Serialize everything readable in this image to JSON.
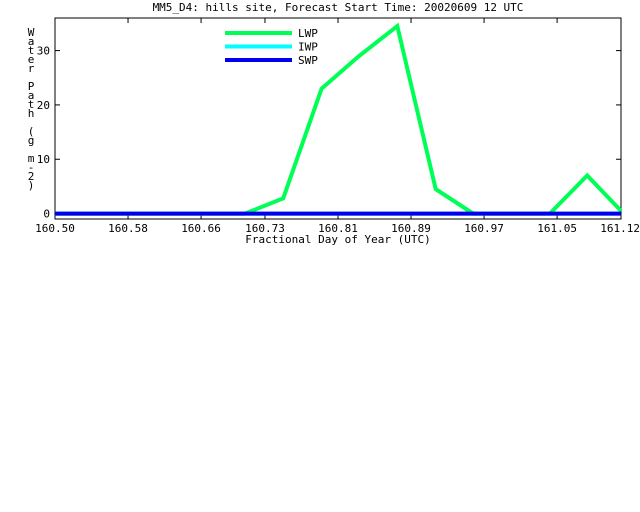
{
  "chart_data": {
    "type": "line",
    "title": "MM5_D4: hills site,  Forecast Start Time: 20020609 12 UTC",
    "xlabel": "Fractional Day of Year (UTC)",
    "ylabel": "Water Path (g m-2)",
    "ylabel_chars": [
      "W",
      "a",
      "t",
      "e",
      "r",
      "",
      "P",
      "a",
      "t",
      "h",
      "",
      "(",
      "g",
      "",
      "m",
      "-",
      "2",
      ")"
    ],
    "xlim": [
      160.5,
      161.12
    ],
    "ylim": [
      -1,
      36
    ],
    "xticks": [
      160.5,
      160.58,
      160.66,
      160.73,
      160.81,
      160.89,
      160.97,
      161.05,
      161.12
    ],
    "xtick_labels": [
      "160.50",
      "160.58",
      "160.66",
      "160.73",
      "160.81",
      "160.89",
      "160.97",
      "161.05",
      "161.12"
    ],
    "yticks": [
      0,
      10,
      20,
      30
    ],
    "ytick_labels": [
      "0",
      "10",
      "20",
      "30"
    ],
    "grid": false,
    "legend_placement": "top-center",
    "series": [
      {
        "name": "LWP",
        "color": "#00ff55",
        "x": [
          160.5,
          160.708,
          160.75,
          160.792,
          160.833,
          160.875,
          160.917,
          160.958,
          161.0,
          161.042,
          161.083,
          161.12
        ],
        "y": [
          0,
          0,
          2.8,
          23,
          29,
          34.5,
          4.5,
          0,
          0,
          0,
          7,
          0.5
        ]
      },
      {
        "name": "IWP",
        "color": "#00ffff",
        "x": [
          160.5,
          161.12
        ],
        "y": [
          0,
          0
        ]
      },
      {
        "name": "SWP",
        "color": "#0000ee",
        "x": [
          160.5,
          161.12
        ],
        "y": [
          0,
          0
        ]
      }
    ]
  }
}
